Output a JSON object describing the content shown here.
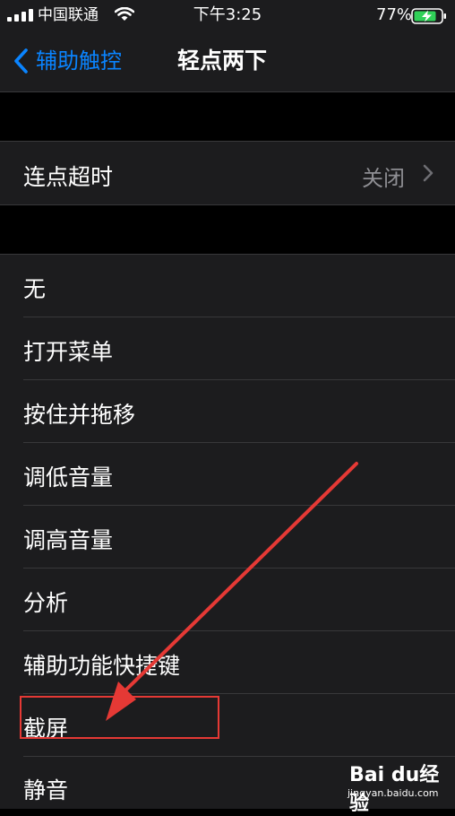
{
  "status_bar": {
    "carrier": "中国联通",
    "time": "下午3:25",
    "battery": "77%"
  },
  "nav": {
    "back_label": "辅助触控",
    "title": "轻点两下"
  },
  "timeout_row": {
    "label": "连点超时",
    "value": "关闭"
  },
  "actions": [
    {
      "label": "无"
    },
    {
      "label": "打开菜单"
    },
    {
      "label": "按住并拖移"
    },
    {
      "label": "调低音量"
    },
    {
      "label": "调高音量"
    },
    {
      "label": "分析"
    },
    {
      "label": "辅助功能快捷键"
    },
    {
      "label": "截屏"
    },
    {
      "label": "静音"
    }
  ],
  "watermark": {
    "brand": "Bai du经验",
    "url": "jingyan.baidu.com"
  },
  "colors": {
    "accent": "#0a84ff",
    "annotation": "#e53935",
    "battery_charging": "#30d158"
  }
}
